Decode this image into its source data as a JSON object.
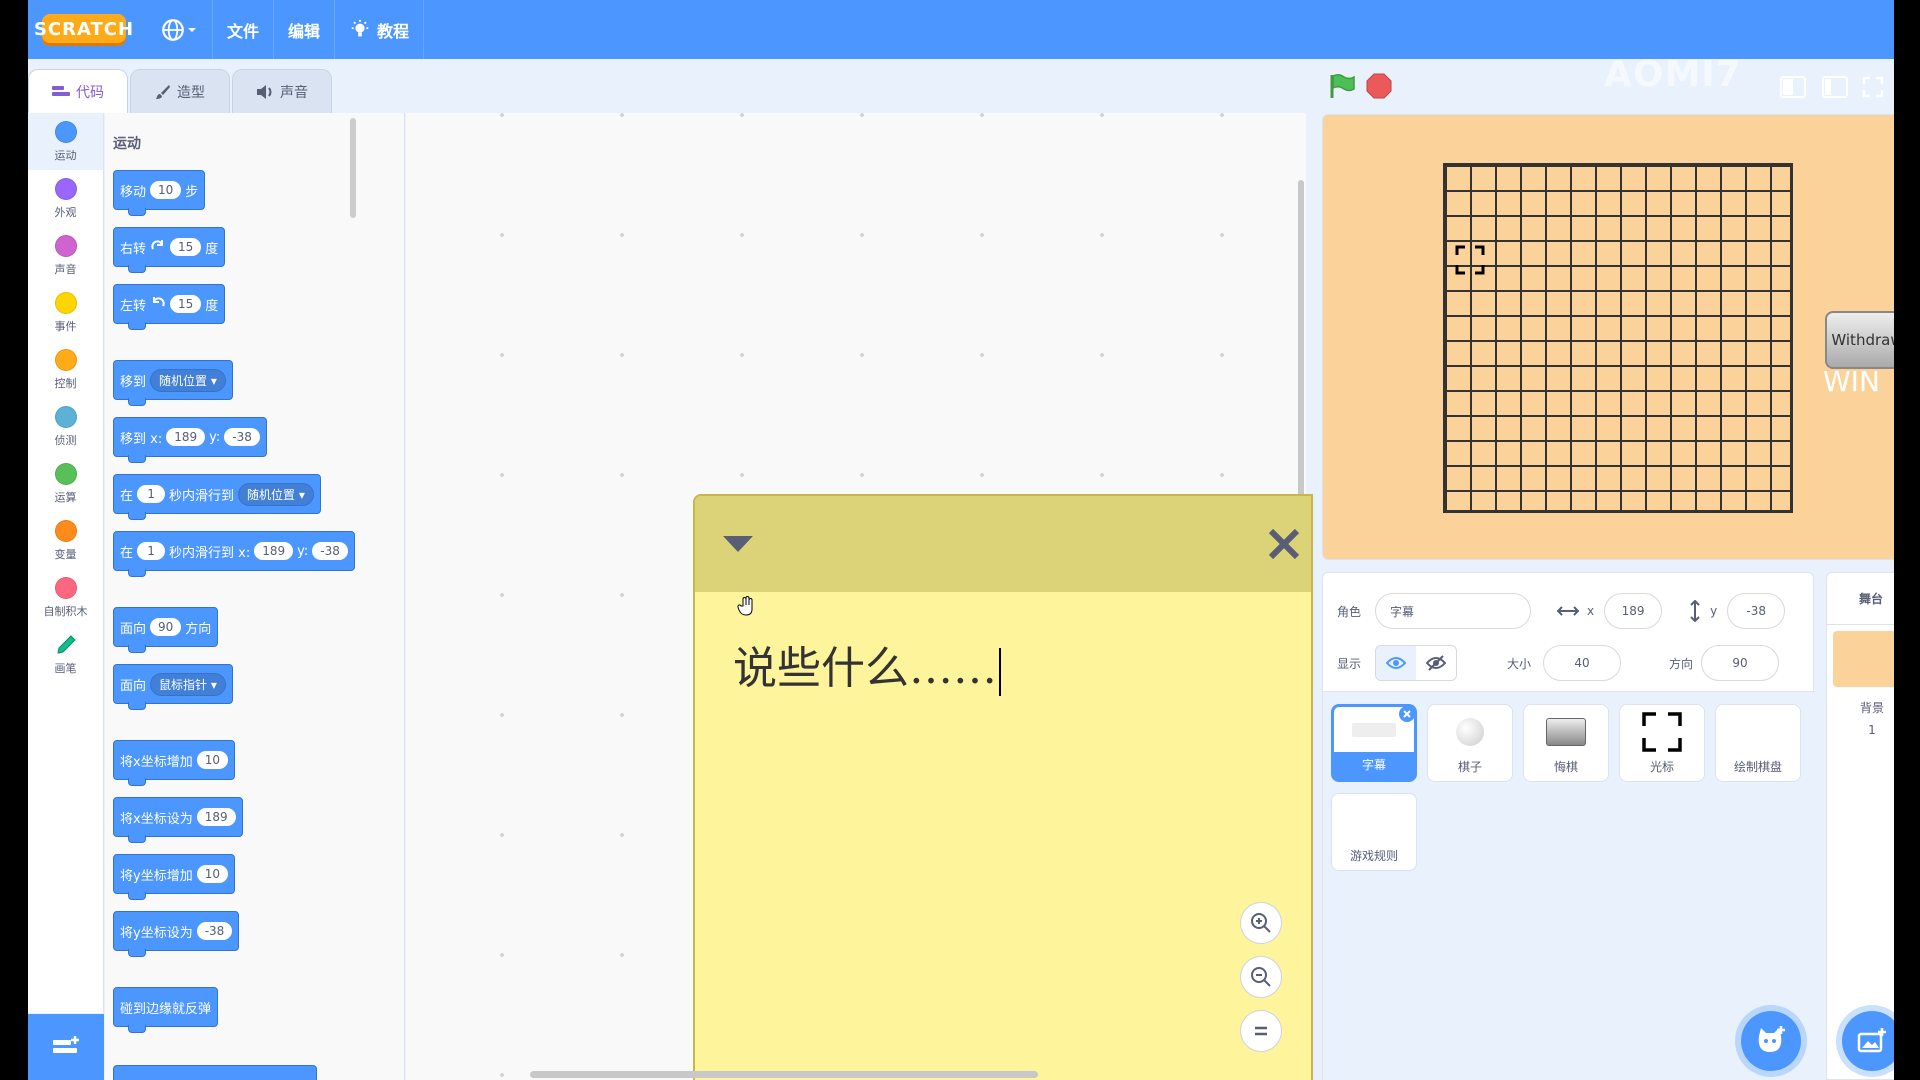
{
  "menu": {
    "logo": "SCRATCH",
    "file": "文件",
    "edit": "编辑",
    "tutorials": "教程"
  },
  "tabs": [
    {
      "label": "代码"
    },
    {
      "label": "造型"
    },
    {
      "label": "声音"
    }
  ],
  "categories": [
    {
      "label": "运动",
      "color": "#4c97ff"
    },
    {
      "label": "外观",
      "color": "#9966ff"
    },
    {
      "label": "声音",
      "color": "#cf63cf"
    },
    {
      "label": "事件",
      "color": "#ffd500"
    },
    {
      "label": "控制",
      "color": "#ffab19"
    },
    {
      "label": "侦测",
      "color": "#5cb1d6"
    },
    {
      "label": "运算",
      "color": "#59c059"
    },
    {
      "label": "变量",
      "color": "#ff8c1a"
    },
    {
      "label": "自制积木",
      "color": "#ff6680"
    },
    {
      "label": "画笔",
      "color": "#0fbd8c"
    }
  ],
  "palette": {
    "title": "运动",
    "move": {
      "a": "移动",
      "n": "10",
      "b": "步"
    },
    "turn_right": {
      "a": "右转",
      "n": "15",
      "b": "度"
    },
    "turn_left": {
      "a": "左转",
      "n": "15",
      "b": "度"
    },
    "goto": {
      "a": "移到",
      "dd": "随机位置"
    },
    "goto_xy": {
      "a": "移到 x:",
      "x": "189",
      "b": "y:",
      "y": "-38"
    },
    "glide": {
      "a": "在",
      "n": "1",
      "b": "秒内滑行到",
      "dd": "随机位置"
    },
    "glide_xy": {
      "a": "在",
      "n": "1",
      "b": "秒内滑行到 x:",
      "x": "189",
      "c": "y:",
      "y": "-38"
    },
    "point_dir": {
      "a": "面向",
      "n": "90",
      "b": "方向"
    },
    "point_towards": {
      "a": "面向",
      "dd": "鼠标指针"
    },
    "change_x": {
      "a": "将x坐标增加",
      "n": "10"
    },
    "set_x": {
      "a": "将x坐标设为",
      "n": "189"
    },
    "change_y": {
      "a": "将y坐标增加",
      "n": "10"
    },
    "set_y": {
      "a": "将y坐标设为",
      "n": "-38"
    },
    "bounce": {
      "a": "碰到边缘就反弹"
    }
  },
  "note": {
    "text": "说些什么……"
  },
  "stage": {
    "withdraw": "Withdraw",
    "win": "WIN",
    "watermark": "AOMI7"
  },
  "sprite_info": {
    "sprite_label": "角色",
    "sprite_name": "字幕",
    "x_label": "x",
    "x": "189",
    "y_label": "y",
    "y": "-38",
    "show_label": "显示",
    "size_label": "大小",
    "size": "40",
    "direction_label": "方向",
    "direction": "90"
  },
  "sprites": [
    {
      "name": "字幕"
    },
    {
      "name": "棋子"
    },
    {
      "name": "悔棋"
    },
    {
      "name": "光标"
    },
    {
      "name": "绘制棋盘"
    },
    {
      "name": "游戏规则"
    }
  ],
  "stage_pane": {
    "title": "舞台",
    "backdrop_label": "背景",
    "backdrop_count": "1"
  },
  "colors": {
    "accent": "#4c97ff",
    "stage_bg": "#fbd39a",
    "note_bg": "#fef49c"
  }
}
